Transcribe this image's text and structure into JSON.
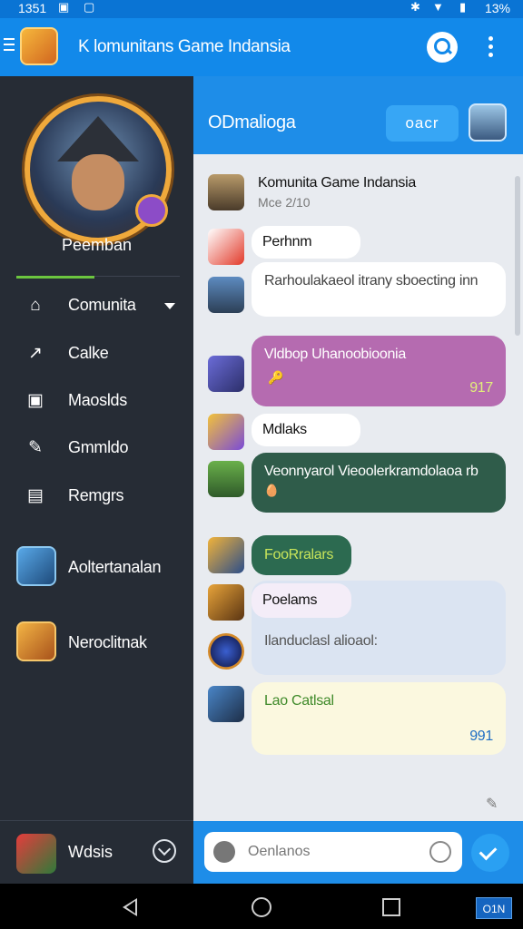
{
  "status_bar": {
    "time": "1351",
    "battery": "13%"
  },
  "app_bar": {
    "title": "K lomunitans Game Indansia"
  },
  "sidebar": {
    "profile_name": "Peemban",
    "items": [
      {
        "label": "Comunita",
        "icon": "home-icon"
      },
      {
        "label": "Calke",
        "icon": "share-icon"
      },
      {
        "label": "Maoslds",
        "icon": "gamepad-icon"
      },
      {
        "label": "Gmmldo",
        "icon": "pen-icon"
      },
      {
        "label": "Remgrs",
        "icon": "document-icon"
      }
    ],
    "games": [
      {
        "label": "Aoltertanalan"
      },
      {
        "label": "Neroclitnak"
      }
    ],
    "footer_label": "Wdsis"
  },
  "chat": {
    "header_title": "ODmalioga",
    "header_button": "oacr",
    "messages": [
      {
        "title": "Komunita Game Indansia",
        "subtitle": "Mce 2/10"
      },
      {
        "text": "Perhnm"
      },
      {
        "text": "Rarhoulakaeol itrany sboecting inn"
      },
      {
        "text": "Vldbop Uhanoobioonia",
        "emoji": "🔑",
        "count": "917"
      },
      {
        "text": "Mdlaks"
      },
      {
        "text": "Veonnyarol Vieoolerkramdolaoa rb",
        "emoji": "🥚"
      },
      {
        "text": "FooRralars"
      },
      {
        "text": "Poelams"
      },
      {
        "text": "Ilanduclasl alioaol:"
      },
      {
        "text": "Lao Catlsal",
        "count": "991"
      }
    ],
    "input_placeholder": "Oenlanos"
  },
  "nav": {
    "chip": "O1N"
  },
  "colors": {
    "primary": "#1289ea",
    "sidebar": "#262c35",
    "accent_green": "#6cc63f"
  }
}
